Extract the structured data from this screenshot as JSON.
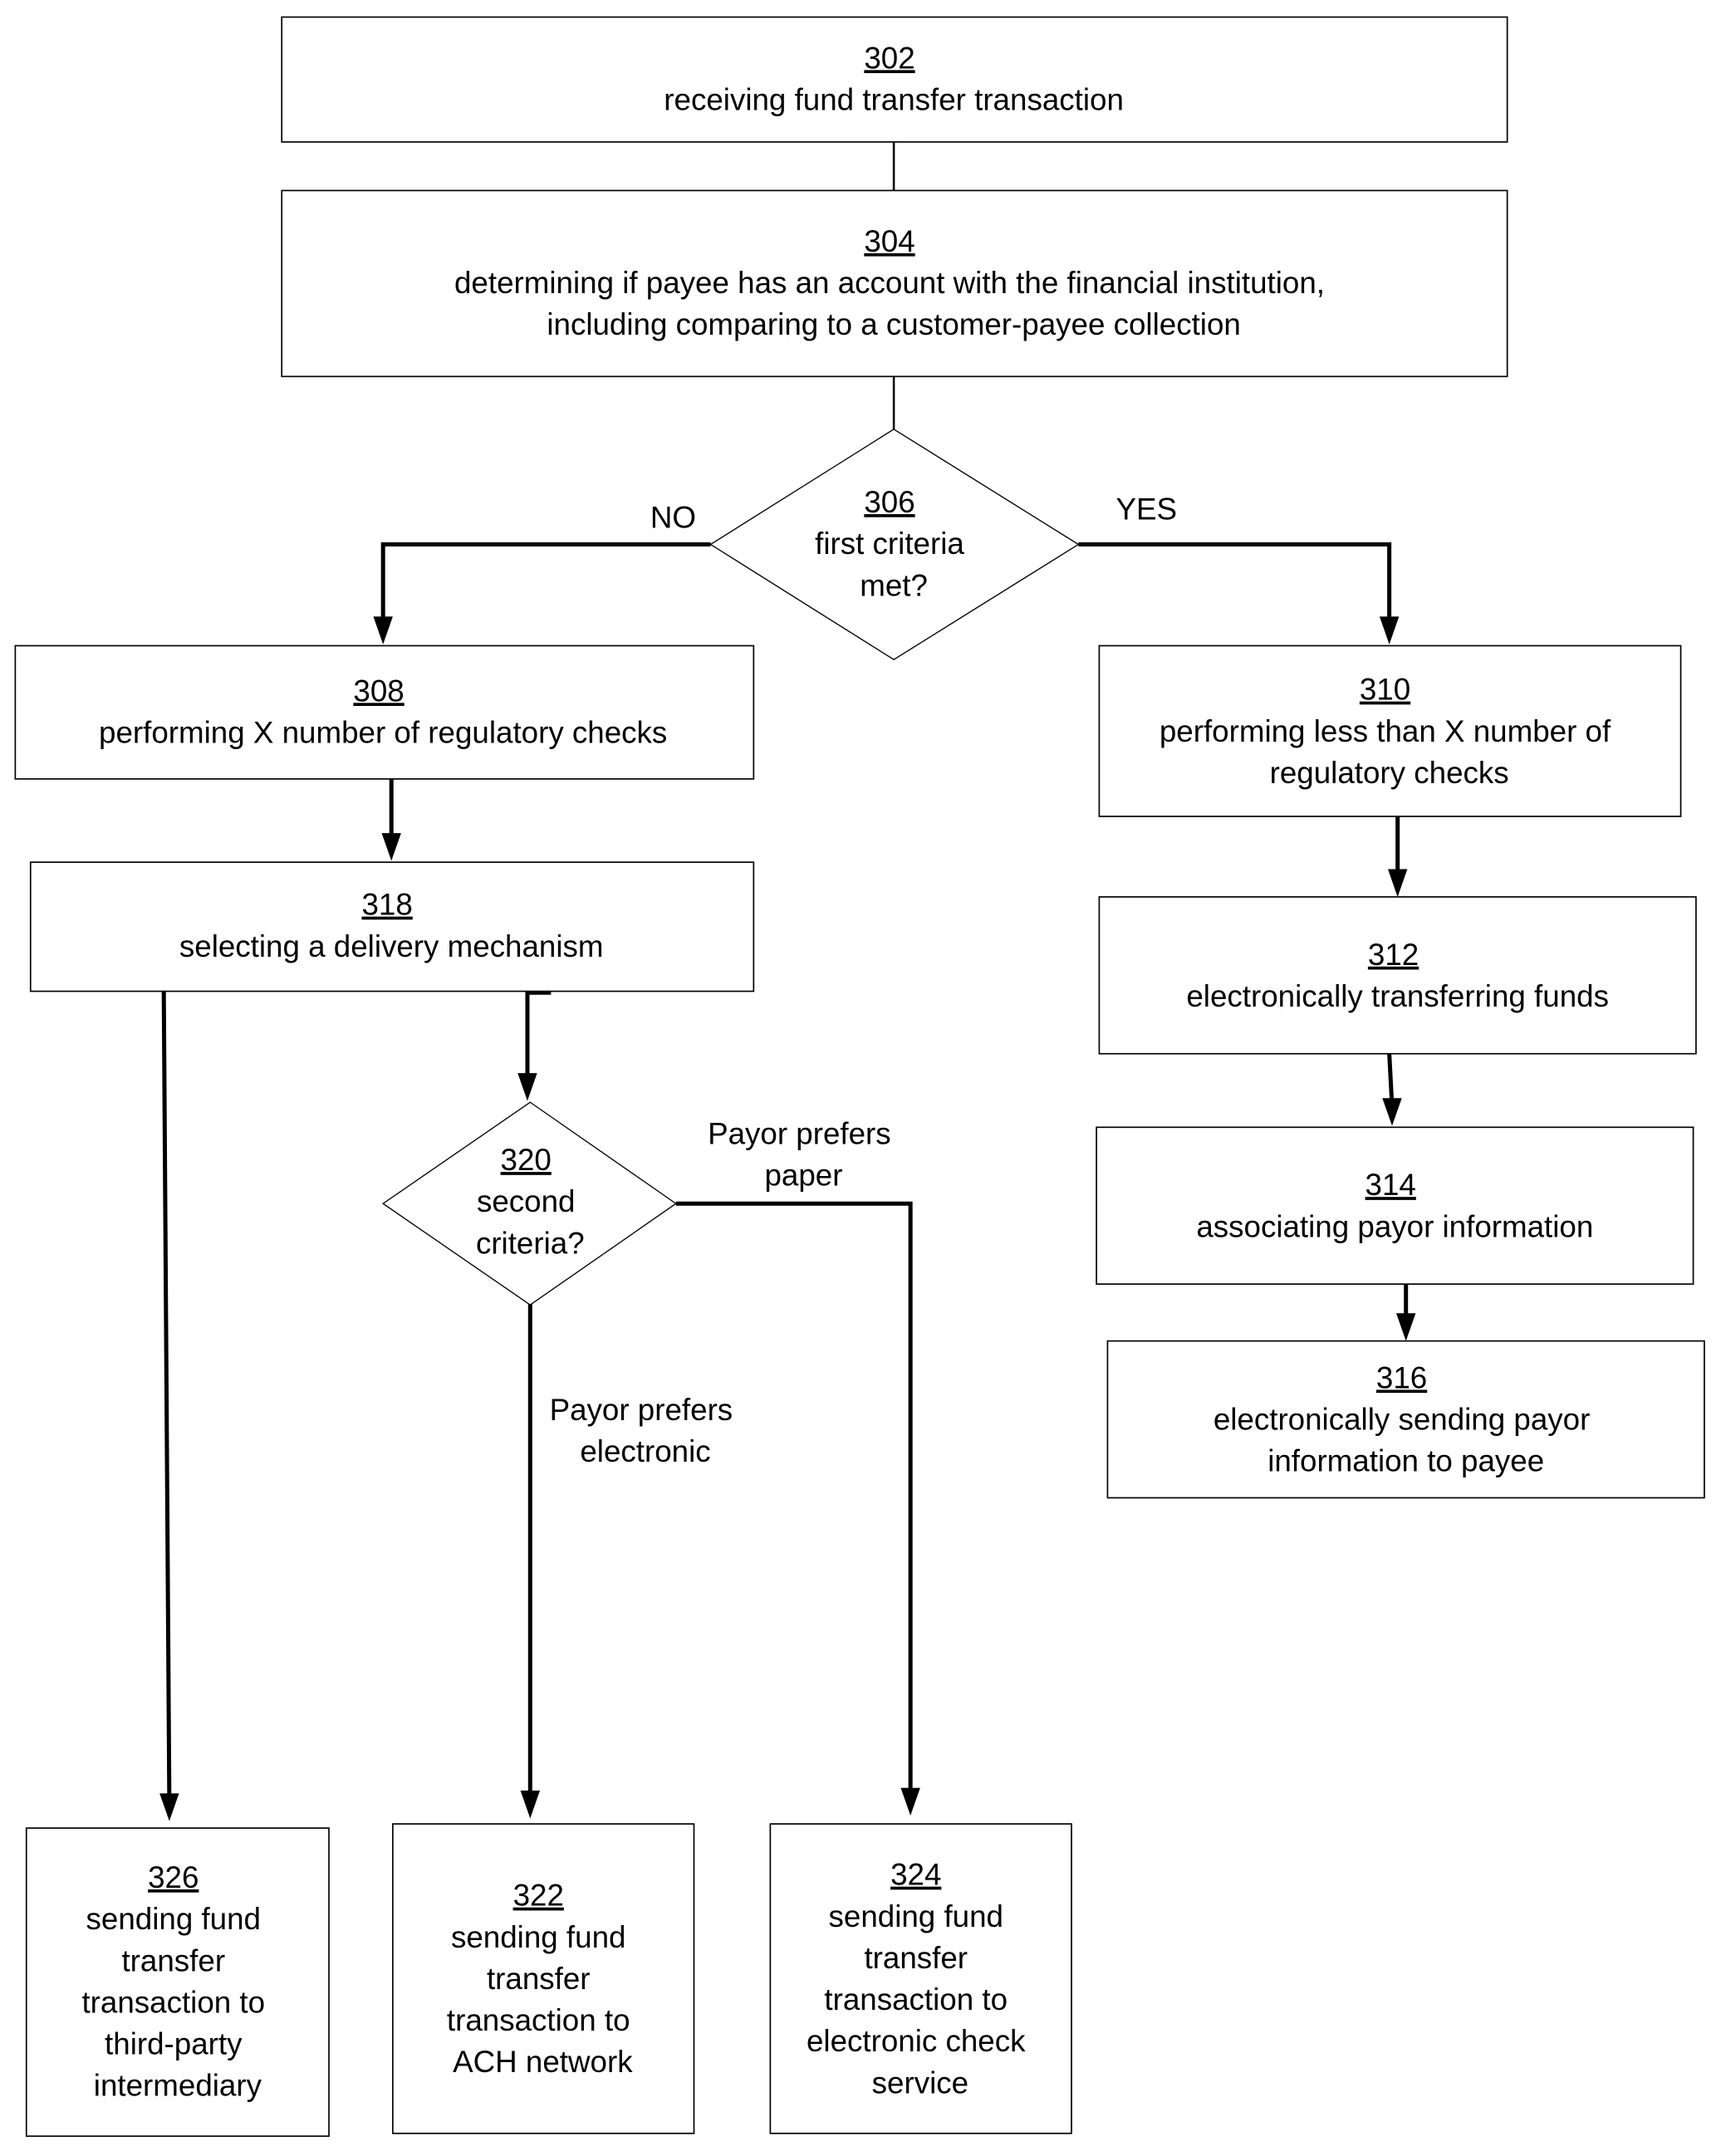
{
  "nodes": {
    "n302": {
      "num": "302",
      "lines": [
        "receiving fund transfer transaction"
      ]
    },
    "n304": {
      "num": "304",
      "lines": [
        "determining if payee has an account with the financial institution,",
        "including comparing to a customer-payee collection"
      ]
    },
    "n306": {
      "num": "306",
      "lines": [
        "first criteria",
        "met?"
      ]
    },
    "n308": {
      "num": "308",
      "lines": [
        "performing X number of regulatory checks"
      ]
    },
    "n310": {
      "num": "310",
      "lines": [
        "performing less than X number of",
        "regulatory checks"
      ]
    },
    "n312": {
      "num": "312",
      "lines": [
        "electronically transferring funds"
      ]
    },
    "n314": {
      "num": "314",
      "lines": [
        "associating payor information"
      ]
    },
    "n316": {
      "num": "316",
      "lines": [
        "electronically sending payor",
        "information to payee"
      ]
    },
    "n318": {
      "num": "318",
      "lines": [
        "selecting a delivery mechanism"
      ]
    },
    "n320": {
      "num": "320",
      "lines": [
        "second",
        "criteria?"
      ]
    },
    "n322": {
      "num": "322",
      "lines": [
        "sending fund",
        "transfer",
        "transaction to",
        "ACH network"
      ]
    },
    "n324": {
      "num": "324",
      "lines": [
        "sending fund",
        "transfer",
        "transaction to",
        "electronic check",
        "service"
      ]
    },
    "n326": {
      "num": "326",
      "lines": [
        "sending fund",
        "transfer",
        "transaction to",
        "third-party",
        "intermediary"
      ]
    }
  },
  "edge_labels": {
    "no": "NO",
    "yes": "YES",
    "paper": [
      "Payor prefers",
      "paper"
    ],
    "electronic": [
      "Payor prefers",
      "electronic"
    ]
  }
}
